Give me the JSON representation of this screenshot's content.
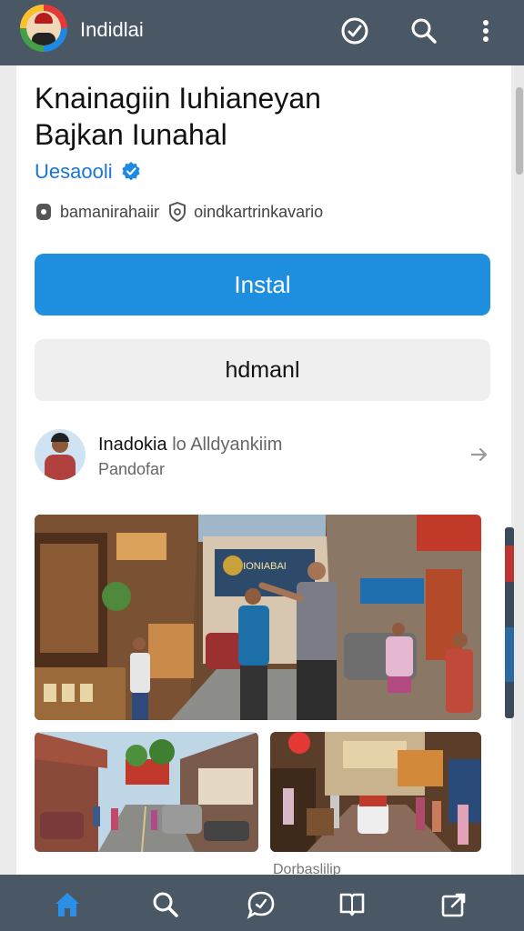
{
  "topbar": {
    "app_title": "Indidlai",
    "icons": [
      "logo-avatar",
      "check-circle-icon",
      "search-icon",
      "more-vertical-icon"
    ]
  },
  "app": {
    "name_line1": "Knainagiin Iuhianeyan",
    "name_line2": "Bajkan Iunahal",
    "developer": "Uesaooli",
    "meta": [
      {
        "icon": "tag-icon",
        "text": "bamanirahaiir"
      },
      {
        "icon": "shield-icon",
        "text": "oindkartrinkavario"
      }
    ]
  },
  "buttons": {
    "install_label": "Instal",
    "secondary_label": "hdmanl"
  },
  "publisher": {
    "name": "Inadokia",
    "secondary": "lo Alldyankiim",
    "subtitle": "Pandofar"
  },
  "screenshots": {
    "main_sign_text": "IONIABAI",
    "peek_text": "Dorbaslilip"
  },
  "bottom_nav": [
    "home-icon",
    "search-icon",
    "chat-icon",
    "book-icon",
    "share-icon"
  ],
  "colors": {
    "bar": "#4a5866",
    "accent": "#1e8fdf",
    "developer": "#1976d2",
    "active_nav": "#2b8fe6"
  }
}
